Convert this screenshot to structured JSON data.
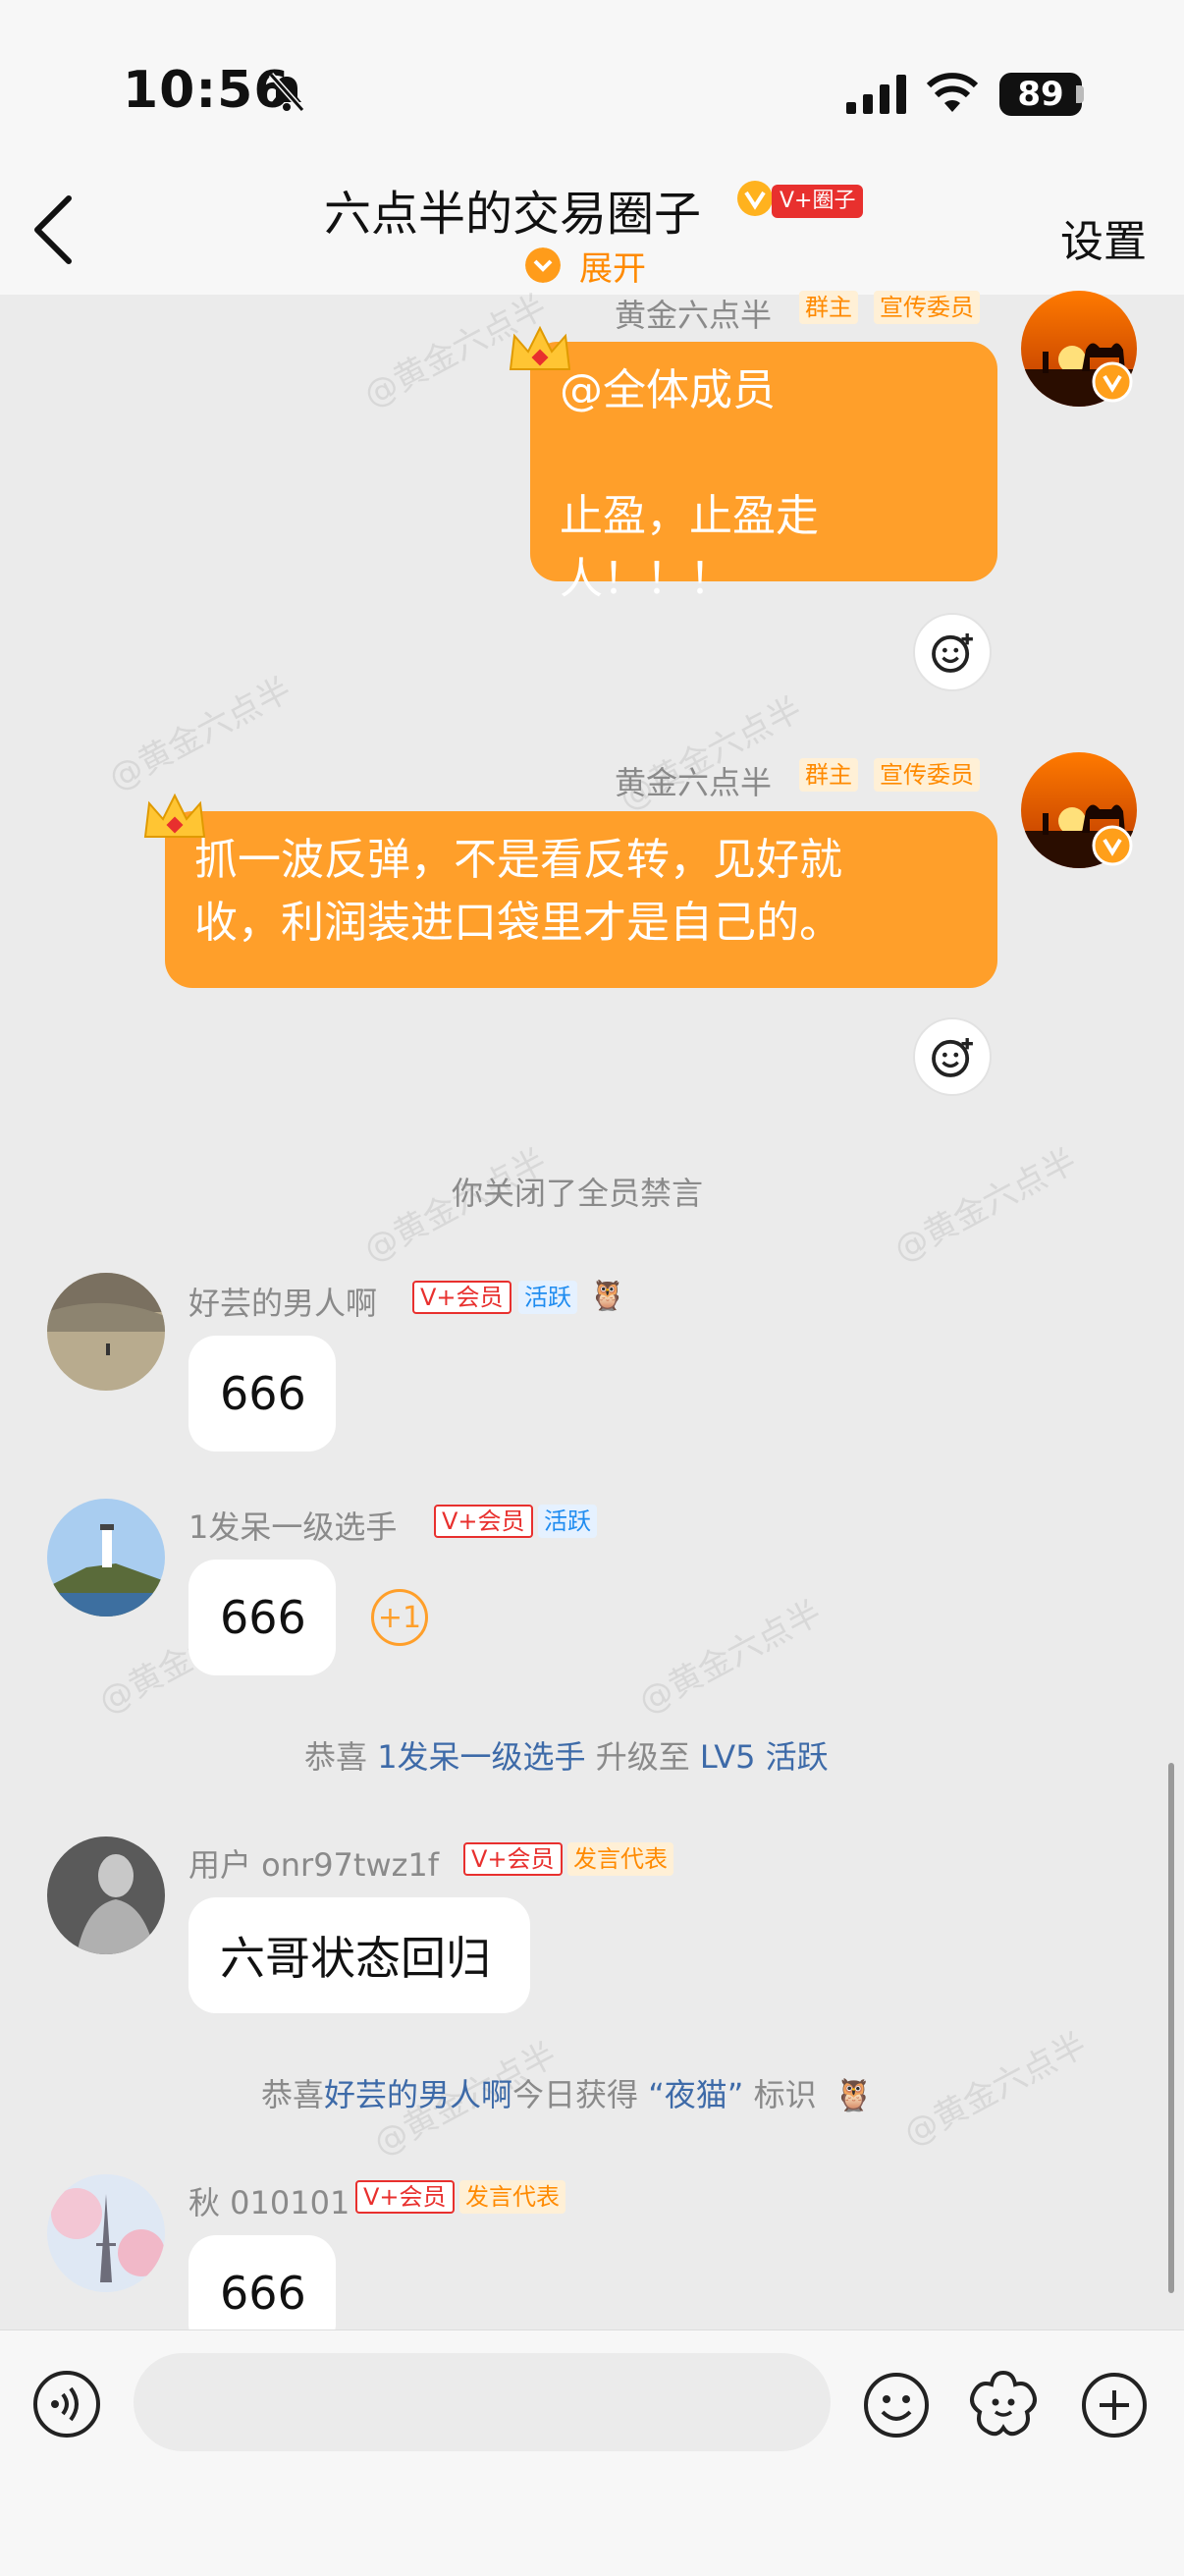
{
  "status_bar": {
    "time": "10:56",
    "battery": "89"
  },
  "header": {
    "title": "六点半的交易圈子",
    "badge": "V+圈子",
    "expand_label": "展开",
    "settings_label": "设置"
  },
  "watermark": "@黄金六点半",
  "messages": [
    {
      "sender": "黄金六点半",
      "tags": [
        "群主",
        "宣传委员"
      ],
      "text_line1": "@全体成员",
      "text_line2": "止盈，止盈走人！！！"
    },
    {
      "sender": "黄金六点半",
      "tags": [
        "群主",
        "宣传委员"
      ],
      "text_line1": "抓一波反弹，不是看反转，见好就",
      "text_line2": "收，利润装进口袋里才是自己的。"
    }
  ],
  "system_1": "你关闭了全员禁言",
  "chat": [
    {
      "sender": "好芸的男人啊",
      "vip": "V+会员",
      "tag": "活跃",
      "text": "666"
    },
    {
      "sender": "1发呆一级选手",
      "vip": "V+会员",
      "tag": "活跃",
      "text": "666",
      "plus": "+1"
    },
    {
      "sender": "用户 onr97twz1f",
      "vip": "V+会员",
      "tag": "发言代表",
      "text": "六哥状态回归"
    },
    {
      "sender": "秋 010101",
      "vip": "V+会员",
      "tag": "发言代表",
      "text": "666"
    }
  ],
  "system_2": {
    "prefix": "恭喜 ",
    "user": "1发呆一级选手",
    "middle": " 升级至 ",
    "level": "LV5 活跃"
  },
  "system_3": {
    "prefix": "恭喜",
    "user": "好芸的男人啊",
    "middle": "今日获得 ",
    "mark": "“夜猫”",
    "suffix": " 标识"
  },
  "colors": {
    "accent": "#ff9f2a",
    "vip_red": "#e8302e",
    "link": "#3d6aa8"
  }
}
